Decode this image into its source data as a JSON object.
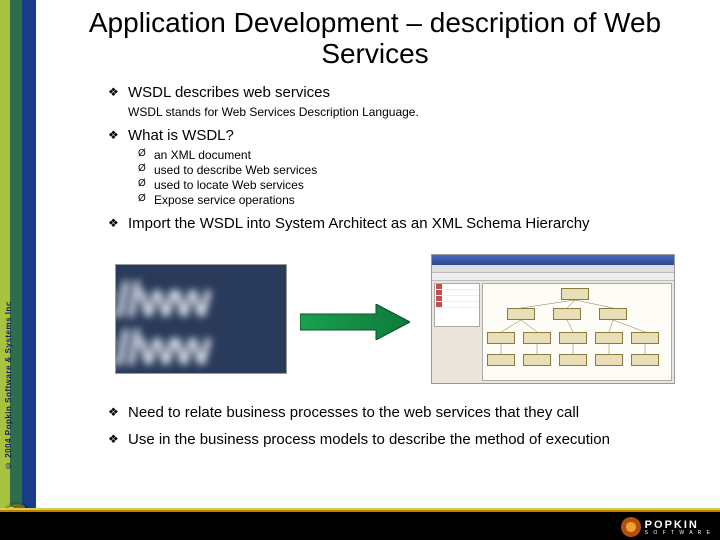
{
  "title": "Application Development – description of Web Services",
  "copyright": "© 2004 Popkin Software & Systems Inc",
  "bullets": {
    "b1": "WSDL describes web services",
    "b1_sub": "WSDL stands for Web Services Description Language.",
    "b2": "What is WSDL?",
    "b2_items": {
      "i0": "an XML document",
      "i1": "used to describe Web services",
      "i2": "used to locate Web services",
      "i3": "Expose service operations"
    },
    "b3": "Import the WSDL into System Architect as an XML Schema Hierarchy",
    "b4": "Need to relate business processes to the web services that they call",
    "b5": "Use in the business process models to describe the method of execution"
  },
  "blur_line1": "://ww",
  "blur_line2": "://ww",
  "logo": {
    "name": "POPKIN",
    "sub": "S O F T W A R E"
  }
}
